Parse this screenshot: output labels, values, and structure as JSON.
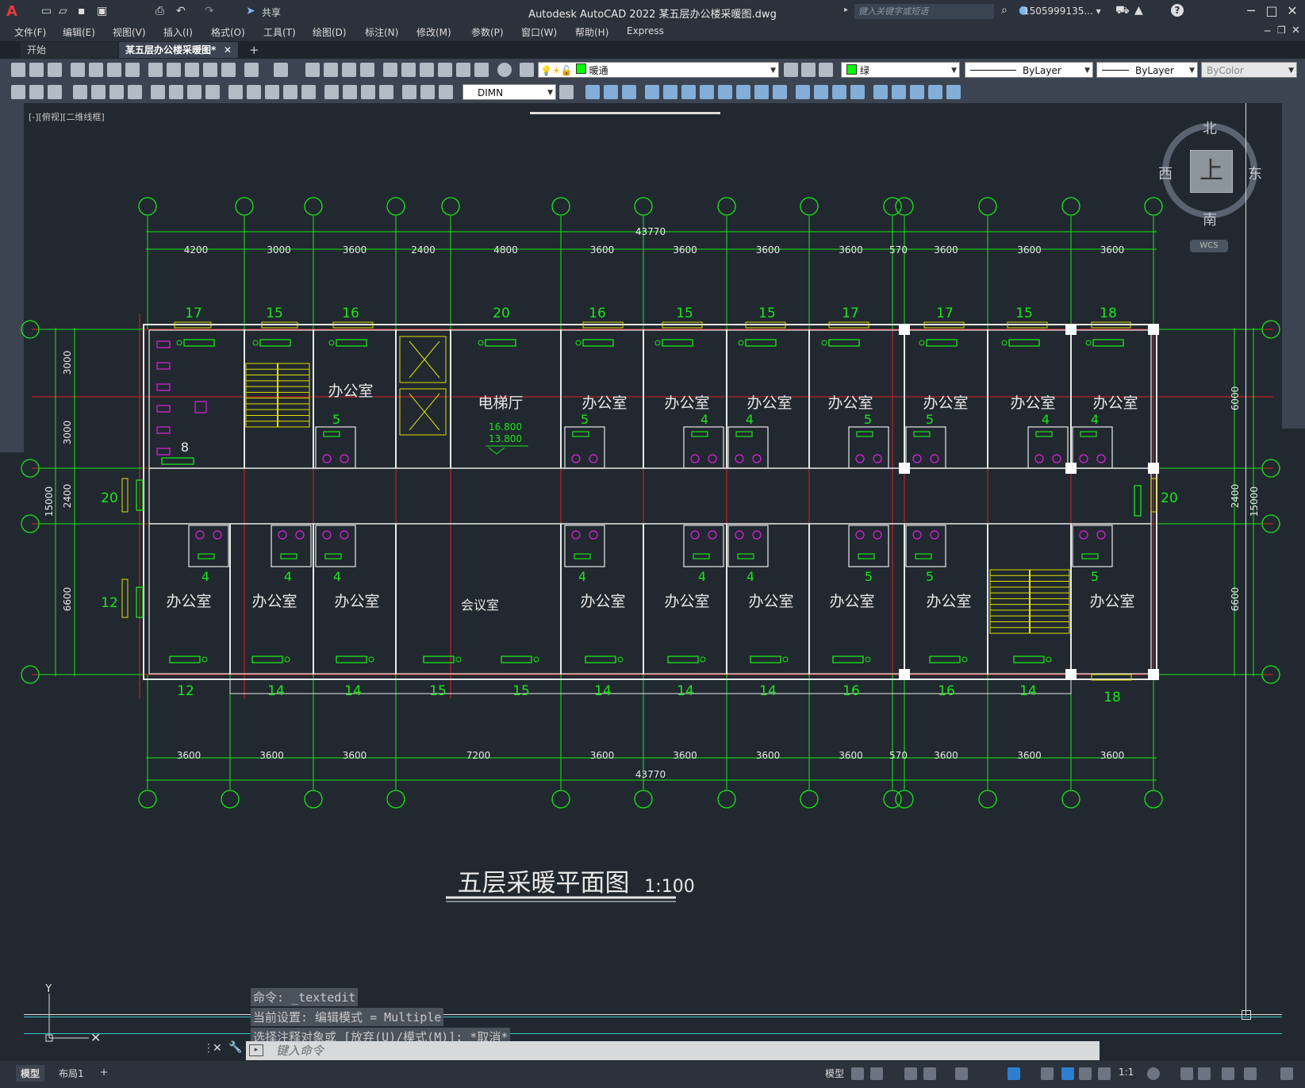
{
  "app": {
    "title": "Autodesk AutoCAD 2022    某五层办公楼采暖图.dwg",
    "share_label": "共享",
    "search_placeholder": "键入关键字或短语",
    "user": "1505999135... ▾"
  },
  "menu": [
    "文件(F)",
    "编辑(E)",
    "视图(V)",
    "插入(I)",
    "格式(O)",
    "工具(T)",
    "绘图(D)",
    "标注(N)",
    "修改(M)",
    "参数(P)",
    "窗口(W)",
    "帮助(H)",
    "Express"
  ],
  "tabs": {
    "start": "开始",
    "active": "某五层办公楼采暖图*"
  },
  "toolbar": {
    "layer": "暖通",
    "color": "绿",
    "linetype": "ByLayer",
    "lineweight": "ByLayer",
    "plotstyle": "ByColor",
    "dimstyle": "DIMN"
  },
  "viewport_label": "[-][俯视][二维线框]",
  "viewcube": {
    "top": "上",
    "north": "北",
    "south": "南",
    "east": "东",
    "west": "西",
    "wcs": "WCS"
  },
  "drawing": {
    "title": "五层采暖平面图",
    "scale": "1:100",
    "top_total": "43770",
    "bottom_total": "43770",
    "top_dims": [
      "4200",
      "3000",
      "3600",
      "2400",
      "4800",
      "3600",
      "3600",
      "3600",
      "3600",
      "570",
      "3600",
      "3600",
      "3600"
    ],
    "bottom_dims": [
      "3600",
      "3600",
      "3600",
      "7200",
      "3600",
      "3600",
      "3600",
      "3600",
      "570",
      "3600",
      "3600",
      "3600"
    ],
    "left_dims": [
      "3000",
      "3000",
      "2400",
      "6600"
    ],
    "left_total": "15000",
    "right_dims": [
      "6000",
      "2400",
      "6600"
    ],
    "right_total": "15000",
    "top_numbers": [
      "17",
      "15",
      "16",
      "20",
      "16",
      "15",
      "15",
      "17",
      "17",
      "15",
      "18"
    ],
    "bottom_numbers": [
      "12",
      "14",
      "14",
      "15",
      "15",
      "14",
      "14",
      "14",
      "16",
      "16",
      "14",
      "18"
    ],
    "side_numbers": {
      "left_mid": "20",
      "left_low": "12",
      "right_mid": "20"
    },
    "upper_rooms": [
      "办公室",
      "电梯厅",
      "办公室",
      "办公室",
      "办公室",
      "办公室",
      "办公室",
      "办公室",
      "办公室"
    ],
    "lower_rooms": [
      "办公室",
      "办公室",
      "办公室",
      "会议室",
      "办公室",
      "办公室",
      "办公室",
      "办公室",
      "办公室",
      "办公室"
    ],
    "elevation": [
      "16.800",
      "13.800"
    ],
    "upper_bath_numbers": [
      "8",
      "5",
      "5",
      "4",
      "4",
      "5",
      "5",
      "4",
      "4"
    ],
    "lower_bath_numbers": [
      "4",
      "4",
      "4",
      "4",
      "4",
      "4",
      "5",
      "5",
      "5"
    ]
  },
  "command": {
    "history": [
      "命令: _textedit",
      "当前设置: 编辑模式 = Multiple",
      "选择注释对象或 [放弃(U)/模式(M)]: *取消*"
    ],
    "prompt": "键入命令"
  },
  "status": {
    "model_tab": "模型",
    "layout_tab": "布局1",
    "model_label": "模型",
    "scale": "1:1"
  }
}
